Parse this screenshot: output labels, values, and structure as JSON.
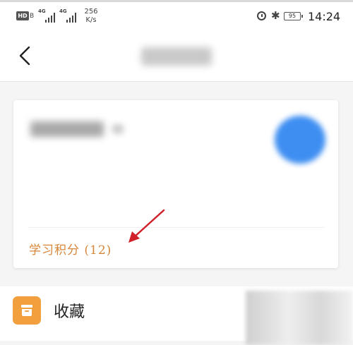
{
  "status_bar": {
    "hd_badge": "HD",
    "hd_sub": "B",
    "signal_1_label": "4G",
    "signal_2_label": "4G",
    "speed_value": "256",
    "speed_unit": "K/s",
    "battery_level": "95",
    "time": "14:24"
  },
  "nav": {
    "back_icon": "chevron-left-icon"
  },
  "profile_card": {
    "score_label": "学习积分 (12)",
    "annotation_color": "#d0212b",
    "accent_color": "#d7863a"
  },
  "list": {
    "favorites": {
      "icon": "archive-box-icon",
      "icon_color": "#f2a03d",
      "label": "收藏"
    }
  }
}
